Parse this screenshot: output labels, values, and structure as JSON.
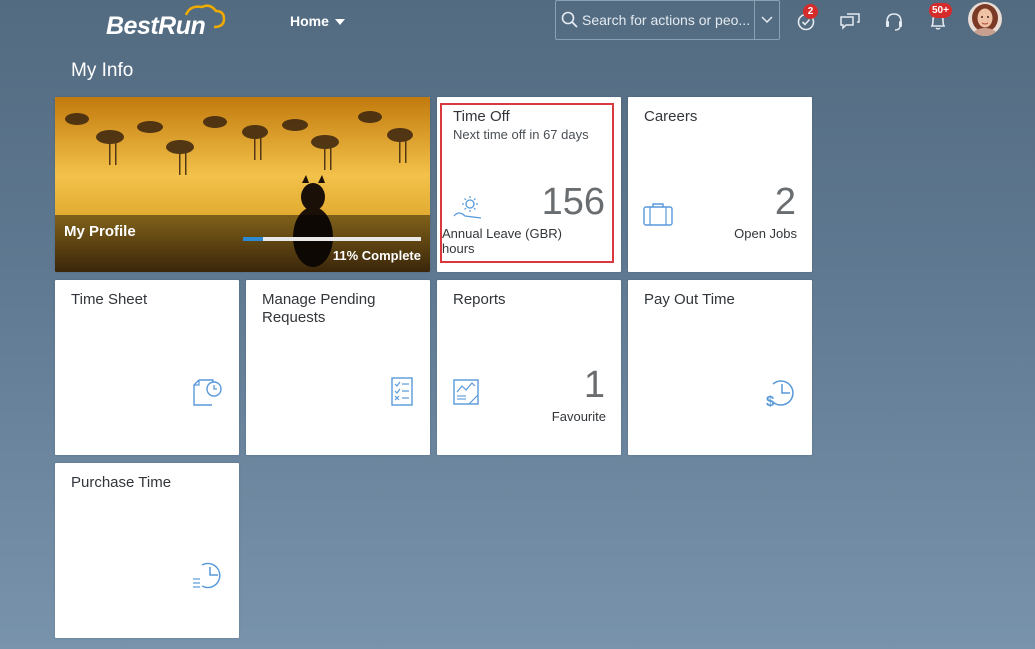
{
  "header": {
    "logo_text": "BestRun",
    "home_label": "Home",
    "search_placeholder": "Search for actions or peo...",
    "approvals_badge": "2",
    "notifications_badge": "50+"
  },
  "page": {
    "title": "My Info"
  },
  "tiles": {
    "profile": {
      "label": "My Profile",
      "progress_text": "11% Complete",
      "progress_fraction": 0.11
    },
    "time_off": {
      "title": "Time Off",
      "subtitle": "Next time off in 67 days",
      "number": "156",
      "unit": "Annual Leave (GBR) hours"
    },
    "careers": {
      "title": "Careers",
      "number": "2",
      "unit": "Open Jobs"
    },
    "time_sheet": {
      "title": "Time Sheet"
    },
    "manage_pending": {
      "title": "Manage Pending Requests"
    },
    "reports": {
      "title": "Reports",
      "number": "1",
      "unit": "Favourite"
    },
    "pay_out_time": {
      "title": "Pay Out Time"
    },
    "purchase_time": {
      "title": "Purchase Time"
    }
  },
  "colors": {
    "background": "#5e7891",
    "tile_icon": "#5899da",
    "highlight": "#d9393e",
    "badge": "#d62b2b"
  },
  "icons": {
    "time_off": "sun-rest-icon",
    "careers": "briefcase-icon",
    "time_sheet": "document-clock-icon",
    "manage_pending": "checklist-icon",
    "reports": "report-chart-icon",
    "pay_out_time": "dollar-clock-icon",
    "purchase_time": "list-clock-icon"
  }
}
